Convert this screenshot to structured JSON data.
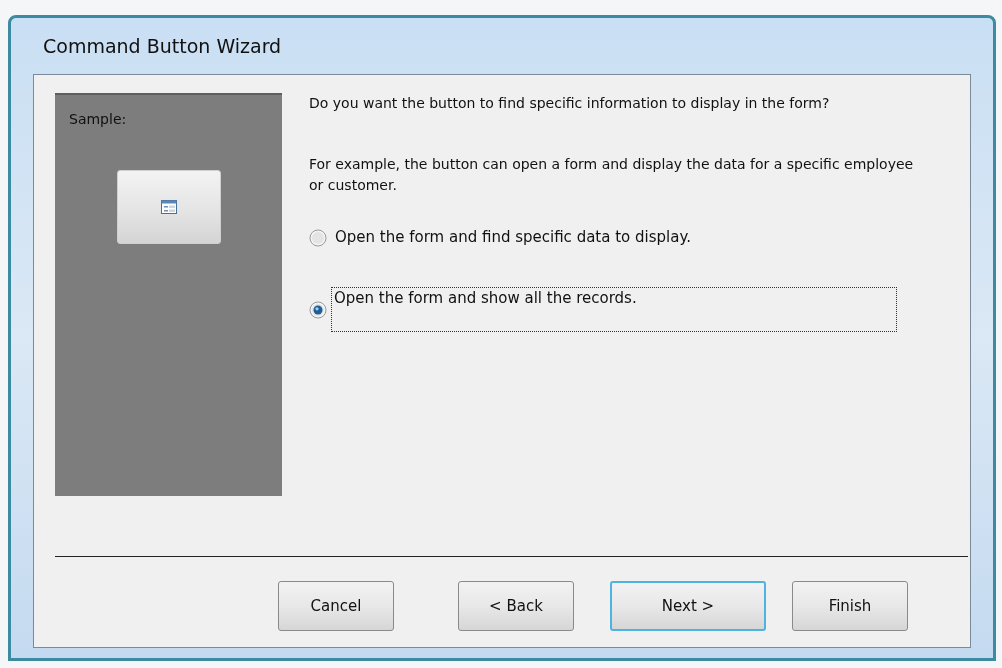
{
  "window": {
    "title": "Command Button Wizard"
  },
  "sample": {
    "label": "Sample:"
  },
  "question": "Do you want the button to find specific information to display in the form?",
  "example": "For example, the button can open a form and display the data for a specific employee or customer.",
  "options": [
    {
      "label": "Open the form and find specific data to display.",
      "selected": false
    },
    {
      "label": "Open the form and show all the records.",
      "selected": true
    }
  ],
  "buttons": [
    {
      "label": "Cancel",
      "default": false
    },
    {
      "label": "< Back",
      "default": false
    },
    {
      "label": "Next >",
      "default": true
    },
    {
      "label": "Finish",
      "default": false
    }
  ]
}
